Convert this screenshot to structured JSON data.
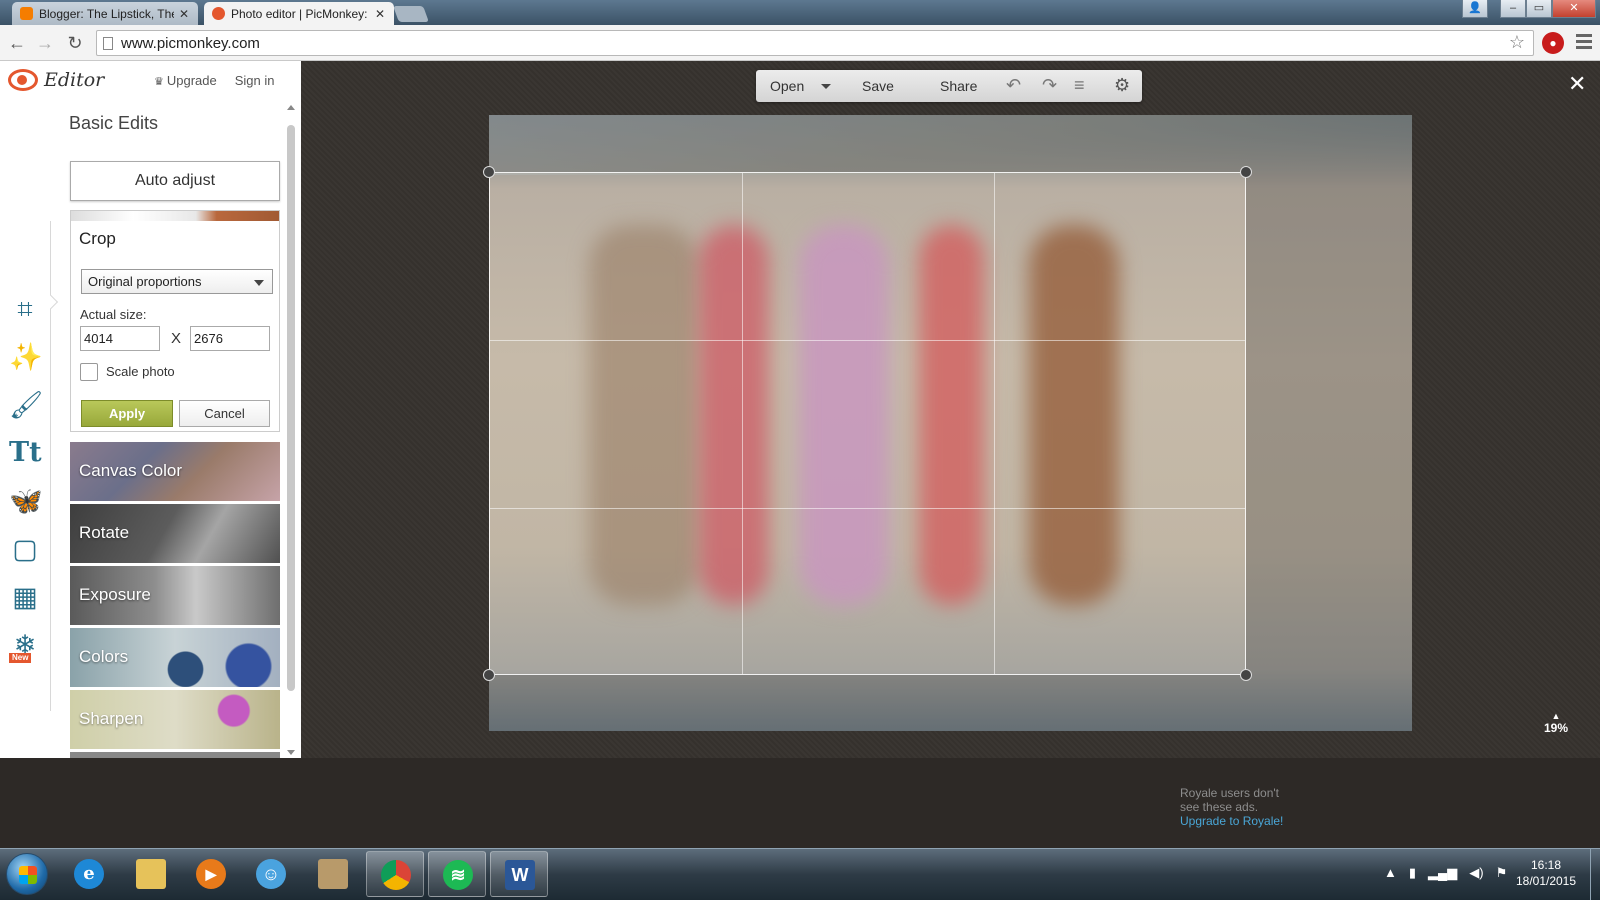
{
  "browser": {
    "tabs": [
      {
        "title": "Blogger: The Lipstick, The",
        "active": false,
        "favicon_color": "#f57d00"
      },
      {
        "title": "Photo editor | PicMonkey:",
        "active": true,
        "favicon_color": "#e4572e"
      }
    ],
    "url": "www.picmonkey.com",
    "window_controls": [
      "minimize",
      "maximize",
      "close"
    ]
  },
  "app": {
    "logo_text": "Editor",
    "upgrade_label": "Upgrade",
    "signin_label": "Sign in",
    "rail_icons": [
      "crop-icon",
      "magic-wand-icon",
      "brush-icon",
      "text-icon",
      "butterfly-icon",
      "frame-icon",
      "texture-icon",
      "snowflake-icon"
    ],
    "rail_new_badge": "New",
    "panel_title": "Basic Edits",
    "auto_adjust_label": "Auto adjust",
    "crop": {
      "title": "Crop",
      "proportion_selected": "Original proportions",
      "actual_size_label": "Actual size:",
      "width": "4014",
      "height": "2676",
      "separator": "X",
      "scale_photo_label": "Scale photo",
      "scale_photo_checked": false,
      "apply_label": "Apply",
      "cancel_label": "Cancel"
    },
    "tools": [
      {
        "label": "Canvas Color"
      },
      {
        "label": "Rotate"
      },
      {
        "label": "Exposure"
      },
      {
        "label": "Colors"
      },
      {
        "label": "Sharpen"
      }
    ],
    "edit_toolbar": {
      "open_label": "Open",
      "save_label": "Save",
      "share_label": "Share"
    },
    "zoom_level": "19%",
    "ad": {
      "line1": "Royale users don't",
      "line2": "see these ads.",
      "link": "Upgrade to Royale!"
    },
    "accent_color": "#e4572e",
    "apply_color": "#a4b443",
    "rail_icon_color": "#2a6f8a"
  },
  "taskbar": {
    "apps": [
      "internet-explorer",
      "file-explorer",
      "media-player",
      "windows-live",
      "library-app",
      "chrome",
      "spotify",
      "word"
    ],
    "time": "16:18",
    "date": "18/01/2015"
  }
}
